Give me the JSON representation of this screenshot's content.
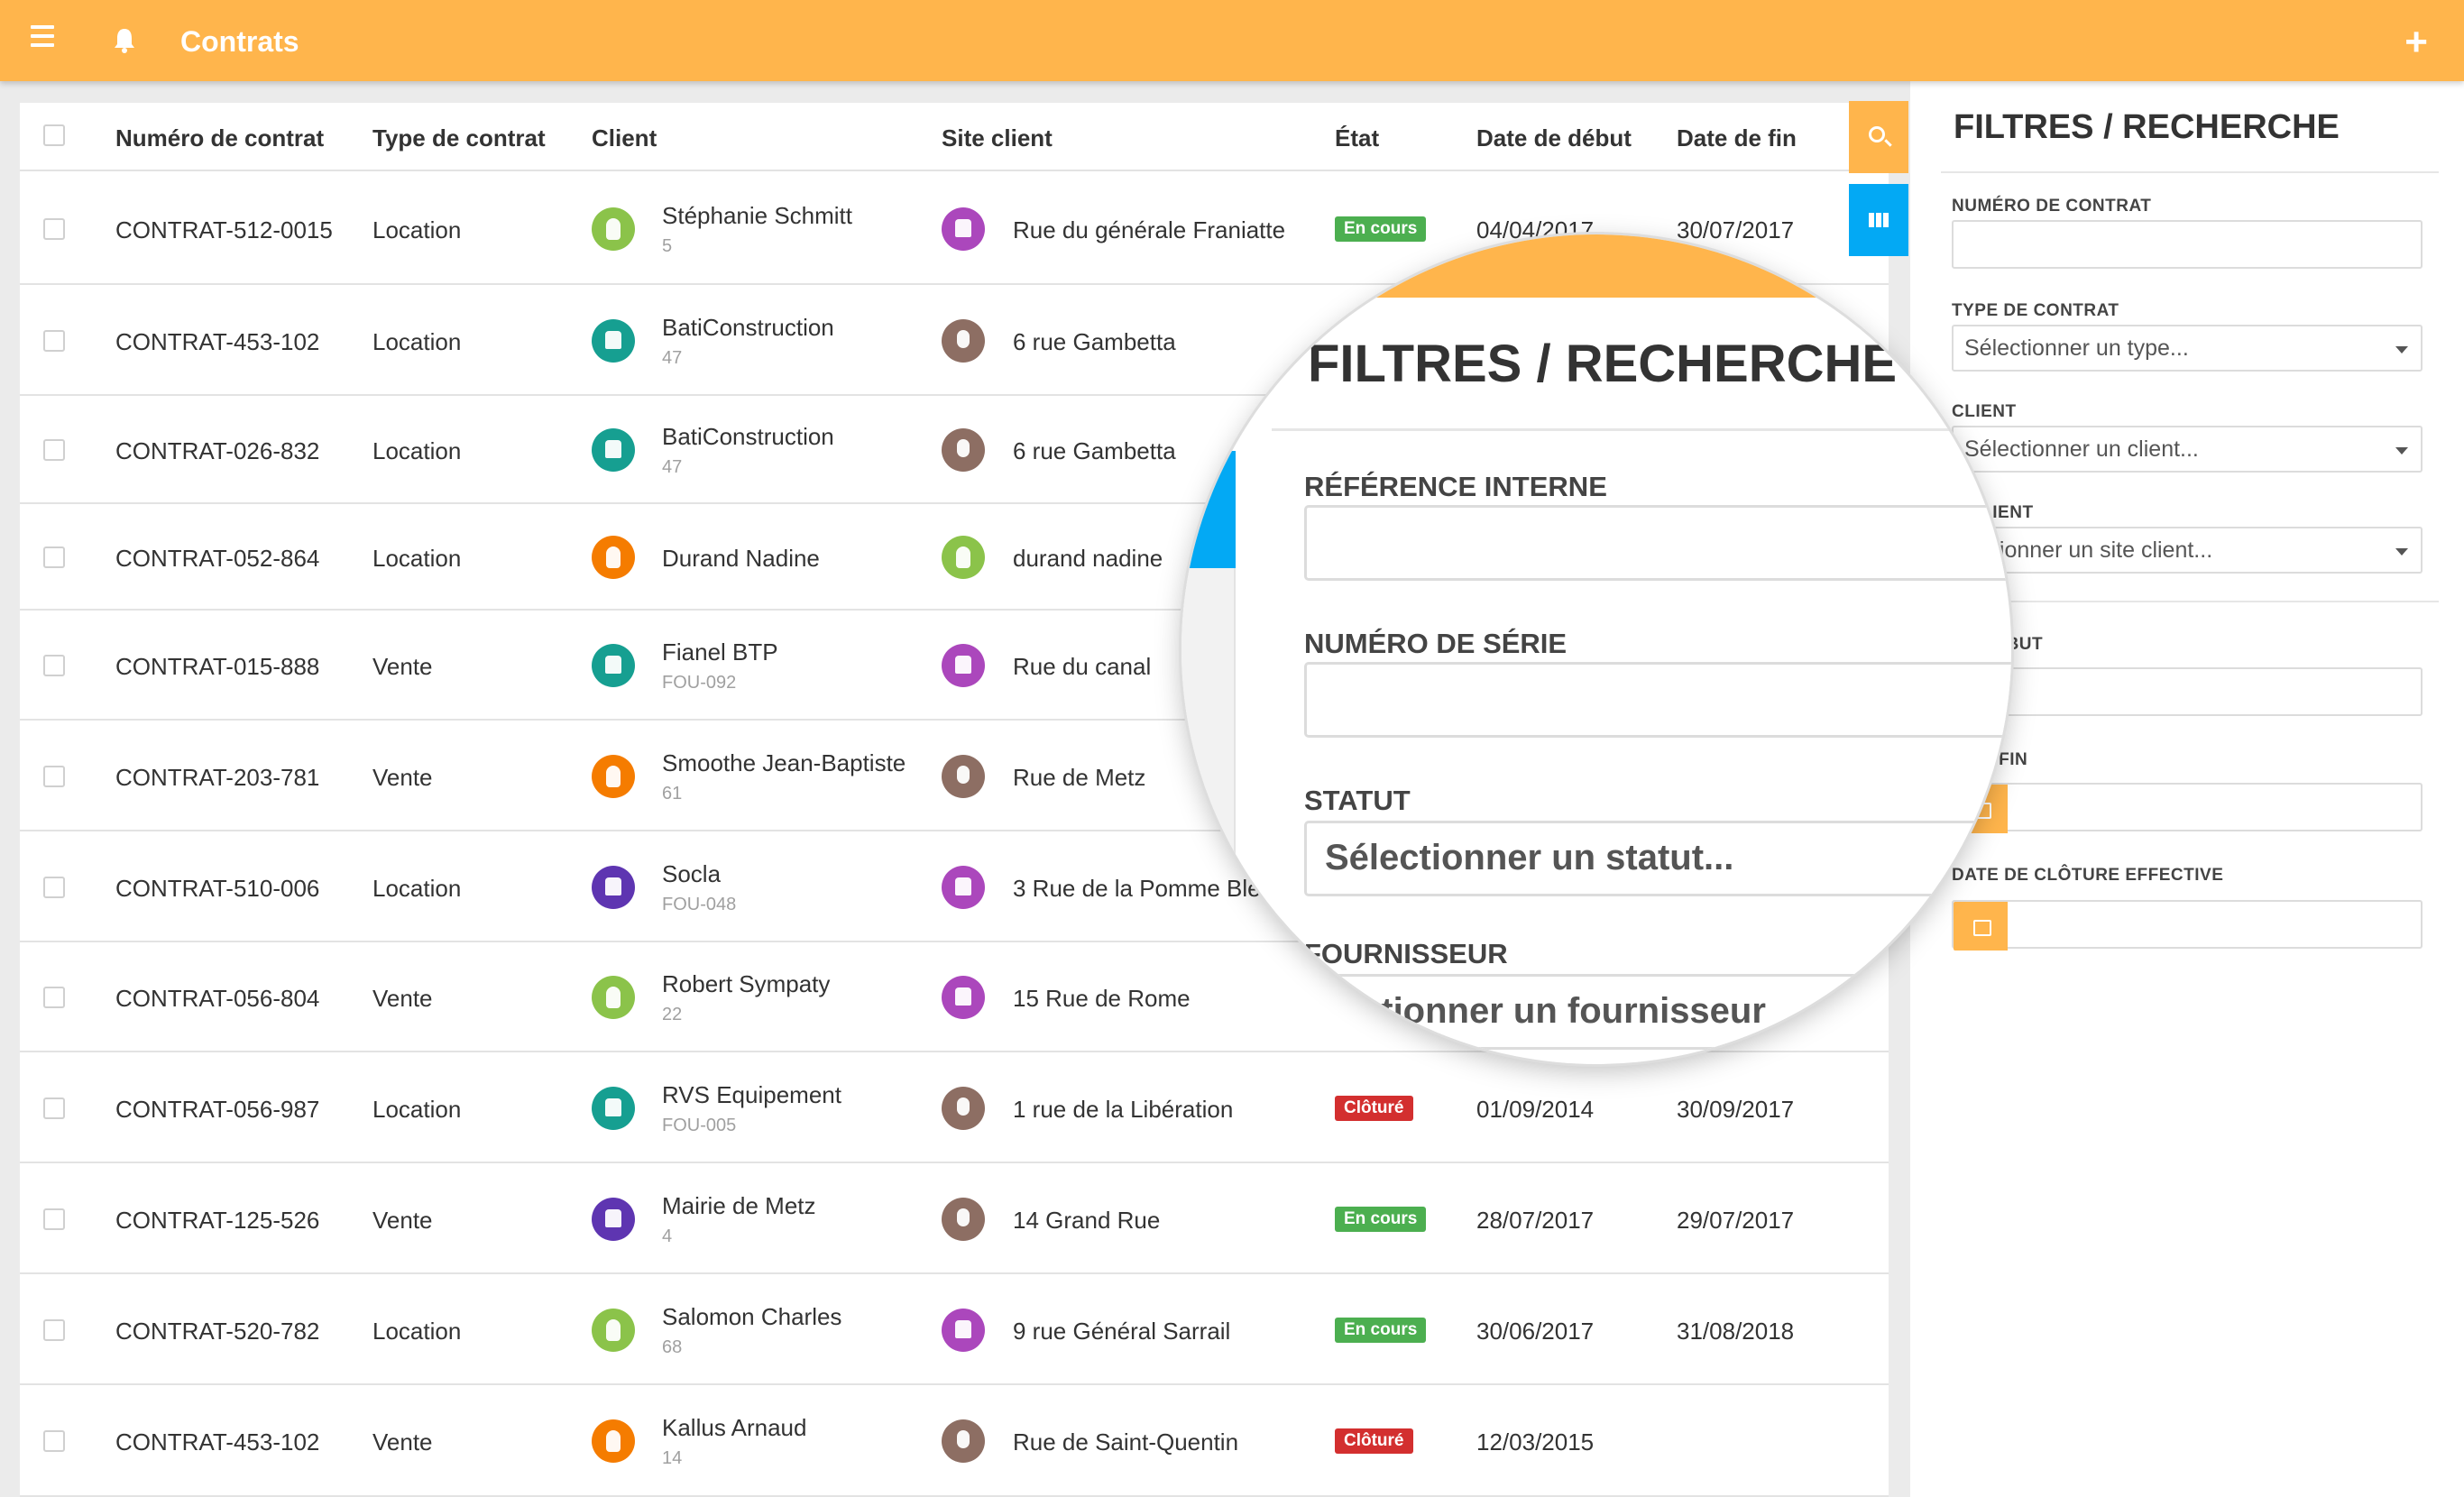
{
  "app": {
    "title": "Contrats",
    "add_label": "+"
  },
  "table": {
    "headers": {
      "numero": "Numéro de contrat",
      "type": "Type de contrat",
      "client": "Client",
      "site": "Site client",
      "etat": "État",
      "debut": "Date de début",
      "fin": "Date de fin"
    },
    "rows": [
      {
        "numero": "CONTRAT-512-0015",
        "type": "Location",
        "client": "Stéphanie Schmitt",
        "client_sub": "5",
        "client_icon": "person-icon",
        "client_color": "#8bc34a",
        "site": "Rue du générale Franiatte",
        "site_icon": "building-icon",
        "site_color": "#ab47bc",
        "etat": "En cours",
        "etat_color": "#4caf50",
        "debut": "04/04/2017",
        "fin": "30/07/2017"
      },
      {
        "numero": "CONTRAT-453-102",
        "type": "Location",
        "client": "BatiConstruction",
        "client_sub": "47",
        "client_icon": "factory-icon",
        "client_color": "#169f91",
        "site": "6 rue Gambetta",
        "site_icon": "map-pin-icon",
        "site_color": "#8d6e63",
        "etat": "",
        "etat_color": "",
        "debut": "",
        "fin": ""
      },
      {
        "numero": "CONTRAT-026-832",
        "type": "Location",
        "client": "BatiConstruction",
        "client_sub": "47",
        "client_icon": "factory-icon",
        "client_color": "#169f91",
        "site": "6 rue Gambetta",
        "site_icon": "map-pin-icon",
        "site_color": "#8d6e63",
        "etat": "",
        "etat_color": "",
        "debut": "",
        "fin": ""
      },
      {
        "numero": "CONTRAT-052-864",
        "type": "Location",
        "client": "Durand Nadine",
        "client_sub": "",
        "client_icon": "person-icon",
        "client_color": "#f57c00",
        "site": "durand nadine",
        "site_icon": "person-icon",
        "site_color": "#8bc34a",
        "etat": "",
        "etat_color": "",
        "debut": "",
        "fin": ""
      },
      {
        "numero": "CONTRAT-015-888",
        "type": "Vente",
        "client": "Fianel BTP",
        "client_sub": "FOU-092",
        "client_icon": "factory-icon",
        "client_color": "#169f91",
        "site": "Rue du canal",
        "site_icon": "building-icon",
        "site_color": "#ab47bc",
        "etat": "",
        "etat_color": "",
        "debut": "",
        "fin": ""
      },
      {
        "numero": "CONTRAT-203-781",
        "type": "Vente",
        "client": "Smoothe Jean-Baptiste",
        "client_sub": "61",
        "client_icon": "person-icon",
        "client_color": "#f57c00",
        "site": "Rue de Metz",
        "site_icon": "map-pin-icon",
        "site_color": "#8d6e63",
        "etat": "",
        "etat_color": "",
        "debut": "",
        "fin": ""
      },
      {
        "numero": "CONTRAT-510-006",
        "type": "Location",
        "client": "Socla",
        "client_sub": "FOU-048",
        "client_icon": "bank-icon",
        "client_color": "#5e35b1",
        "site": "3 Rue de la Pomme Ble",
        "site_icon": "building-icon",
        "site_color": "#ab47bc",
        "etat": "",
        "etat_color": "",
        "debut": "",
        "fin": ""
      },
      {
        "numero": "CONTRAT-056-804",
        "type": "Vente",
        "client": "Robert Sympaty",
        "client_sub": "22",
        "client_icon": "person-icon",
        "client_color": "#8bc34a",
        "site": "15 Rue de Rome",
        "site_icon": "building-icon",
        "site_color": "#ab47bc",
        "etat": "",
        "etat_color": "",
        "debut": "",
        "fin": ""
      },
      {
        "numero": "CONTRAT-056-987",
        "type": "Location",
        "client": "RVS Equipement",
        "client_sub": "FOU-005",
        "client_icon": "factory-icon",
        "client_color": "#169f91",
        "site": "1 rue de la Libération",
        "site_icon": "map-pin-icon",
        "site_color": "#8d6e63",
        "etat": "Clôturé",
        "etat_color": "#d32f2f",
        "debut": "01/09/2014",
        "fin": "30/09/2017"
      },
      {
        "numero": "CONTRAT-125-526",
        "type": "Vente",
        "client": "Mairie de Metz",
        "client_sub": "4",
        "client_icon": "bank-icon",
        "client_color": "#5e35b1",
        "site": "14 Grand Rue",
        "site_icon": "map-pin-icon",
        "site_color": "#8d6e63",
        "etat": "En cours",
        "etat_color": "#4caf50",
        "debut": "28/07/2017",
        "fin": "29/07/2017"
      },
      {
        "numero": "CONTRAT-520-782",
        "type": "Location",
        "client": "Salomon Charles",
        "client_sub": "68",
        "client_icon": "person-icon",
        "client_color": "#8bc34a",
        "site": "9 rue Général Sarrail",
        "site_icon": "building-icon",
        "site_color": "#ab47bc",
        "etat": "En cours",
        "etat_color": "#4caf50",
        "debut": "30/06/2017",
        "fin": "31/08/2018"
      },
      {
        "numero": "CONTRAT-453-102",
        "type": "Vente",
        "client": "Kallus Arnaud",
        "client_sub": "14",
        "client_icon": "person-icon",
        "client_color": "#f57c00",
        "site": "Rue de Saint-Quentin",
        "site_icon": "map-pin-icon",
        "site_color": "#8d6e63",
        "etat": "Clôturé",
        "etat_color": "#d32f2f",
        "debut": "12/03/2015",
        "fin": ""
      }
    ]
  },
  "filters": {
    "title": "FILTRES / RECHERCHE",
    "numero_label": "NUMÉRO DE CONTRAT",
    "type_label": "TYPE DE CONTRAT",
    "type_value": "Sélectionner un type...",
    "client_label": "CLIENT",
    "client_value": "Sélectionner un client...",
    "site_label": "E CLIENT",
    "site_value": "lectionner un site client...",
    "debut_label": "DE DÉBUT",
    "fin_label": "E DE FIN",
    "cloture_label": "DATE DE CLÔTURE EFFECTIVE"
  },
  "magnifier": {
    "title": "FILTRES / RECHERCHE",
    "ref_label": "RÉFÉRENCE INTERNE",
    "serie_label": "NUMÉRO DE SÉRIE",
    "statut_label": "STATUT",
    "statut_value": "Sélectionner un statut...",
    "fournisseur_label": "FOURNISSEUR",
    "fournisseur_value": "ctionner un fournisseur",
    "badge": "En"
  },
  "colors": {
    "accent": "#ffb54c",
    "blue": "#03a9f4",
    "green_badge": "#4caf50",
    "red_badge": "#d32f2f"
  }
}
